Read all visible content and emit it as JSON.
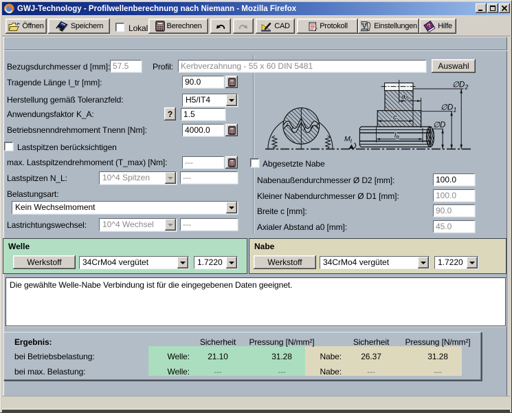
{
  "window": {
    "title": "GWJ-Technology - Profilwellenberechnung nach Niemann - Mozilla Firefox"
  },
  "toolbar": {
    "open": "Öffnen",
    "save": "Speichern",
    "local": "Lokal",
    "calculate": "Berechnen",
    "cad": "CAD",
    "protocol": "Protokoll",
    "settings": "Einstellungen",
    "help": "Hilfe"
  },
  "icons": {
    "titlebar": "firefox-icon",
    "open": "open-folder-icon",
    "save": "floppy-disk-icon",
    "calculate": "calculator-icon",
    "undo": "undo-arrow-icon",
    "redo": "redo-arrow-icon",
    "cad": "drawing-pen-icon",
    "protocol": "document-icon",
    "settings": "tools-icon",
    "help": "book-icon",
    "spinner": "calculator-icon"
  },
  "form": {
    "ref_diameter_label": "Bezugsdurchmesser d [mm]:",
    "ref_diameter_value": "57.5",
    "profile_label": "Profil:",
    "profile_value": "Kerbverzahnung - 55 x 60 DIN 5481",
    "select_button": "Auswahl",
    "length_label": "Tragende Länge l_tr [mm]:",
    "length_value": "90.0",
    "tolerance_label": "Herstellung gemäß Toleranzfeld:",
    "tolerance_value": "H5/IT4",
    "app_factor_label": "Anwendungsfaktor K_A:",
    "question_button": "?",
    "app_factor_value": "1.5",
    "torque_label": "Betriebsnenndrehmoment Tnenn [Nm]:",
    "torque_value": "4000.0",
    "peaks_checkbox_label": "Lastspitzen berücksichtigen",
    "max_torque_label": "max. Lastspitzendrehmoment (T_max) [Nm]:",
    "max_torque_value": "---",
    "peaks_label": "Lastspitzen N_L:",
    "peaks_value": "10^4 Spitzen",
    "peaks_count_value": "---",
    "load_type_label": "Belastungsart:",
    "load_type_value": "Kein Wechselmoment",
    "direction_label": "Lastrichtungswechsel:",
    "direction_value": "10^4 Wechsel",
    "direction_count_value": "---"
  },
  "hub_form": {
    "stepped_hub_label": "Abgesetzte Nabe",
    "outer_diameter_label": "Nabenaußendurchmesser Ø D2 [mm]:",
    "outer_diameter_value": "100.0",
    "small_diameter_label": "Kleiner Nabendurchmesser Ø D1 [mm]:",
    "small_diameter_value": "100.0",
    "width_label": "Breite c [mm]:",
    "width_value": "90.0",
    "axial_label": "Axialer Abstand a0 [mm]:",
    "axial_value": "45.0"
  },
  "drawing": {
    "d2": "∅D",
    "d2_sub": "2",
    "d1": "∅D",
    "d1_sub": "1",
    "d": "∅D",
    "a0": "a",
    "a0_sub": "0",
    "c": "c",
    "ltr": "l",
    "ltr_sub": "tr",
    "mt": "M",
    "mt_sub": "t"
  },
  "shaft_panel": {
    "title": "Welle",
    "material_button": "Werkstoff",
    "material": "34CrMo4 vergütet",
    "material_number": "1.7220"
  },
  "hub_panel": {
    "title": "Nabe",
    "material_button": "Werkstoff",
    "material": "34CrMo4 vergütet",
    "material_number": "1.7220"
  },
  "message": "Die gewählte Welle-Nabe Verbindung ist für die eingegebenen Daten geeignet.",
  "results": {
    "title": "Ergebnis:",
    "col_safety": "Sicherheit",
    "col_pressure": "Pressung [N/mm²]",
    "row_operating": "bei Betriebsbelastung:",
    "row_max": "bei max. Belastung:",
    "shaft_label": "Welle:",
    "hub_label": "Nabe:",
    "operating": {
      "shaft_safety": "21.10",
      "shaft_pressure": "31.28",
      "hub_safety": "26.37",
      "hub_pressure": "31.28"
    },
    "max": {
      "shaft_safety": "---",
      "shaft_pressure": "---",
      "hub_safety": "---",
      "hub_pressure": "---"
    }
  },
  "colors": {
    "titlebar_left": "#102879",
    "titlebar_right": "#9dc0ec",
    "chrome": "#d4d0c8",
    "content_bg": "#aeb9c4",
    "shaft_green": "#b2dfc3",
    "hub_tan": "#dcd8bc"
  }
}
